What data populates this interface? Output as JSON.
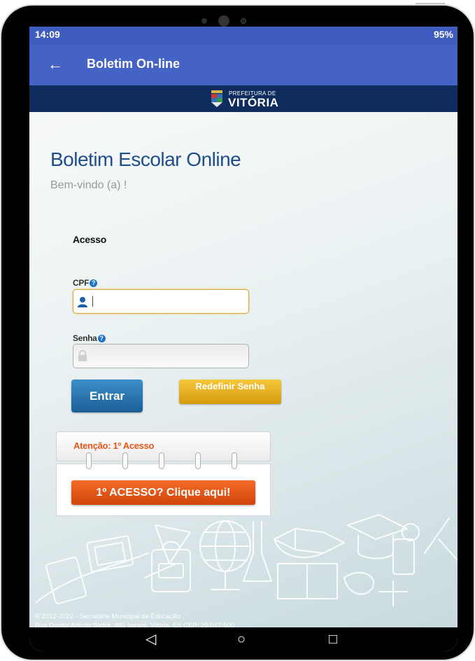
{
  "status_bar": {
    "time": "14:09",
    "right": "95%"
  },
  "app_bar": {
    "back_icon": "arrow-left-icon",
    "title": "Boletim On-line"
  },
  "brand": {
    "line1": "PREFEITURA DE",
    "line2": "VITÓRIA"
  },
  "page": {
    "title": "Boletim Escolar Online",
    "welcome": "Bem-vindo (a) !"
  },
  "login": {
    "section_label": "Acesso",
    "cpf_label": "CPF",
    "cpf_value": "",
    "senha_label": "Senha",
    "help_glyph": "?",
    "entrar_label": "Entrar",
    "redefinir_label": "Redefinir Senha"
  },
  "notice": {
    "title": "Atenção: 1º Acesso",
    "button_label": "1º ACESSO? Clique aqui!"
  },
  "footer": {
    "line1": "© 2012-2022 - Secretaria Municipal de Educação",
    "line2": "Rua Doutor Arlindo Sodré, 485 Itararé, Vitória, ES CEP: 29.047-500"
  },
  "colors": {
    "app_bar": "#4563c4",
    "brand_bar": "#0e2d5e",
    "title": "#1f4e8a",
    "entrar": "#1b5e96",
    "redefinir": "#d69a0e",
    "notice_title": "#e4581a",
    "primeiro_button": "#d0450b"
  }
}
